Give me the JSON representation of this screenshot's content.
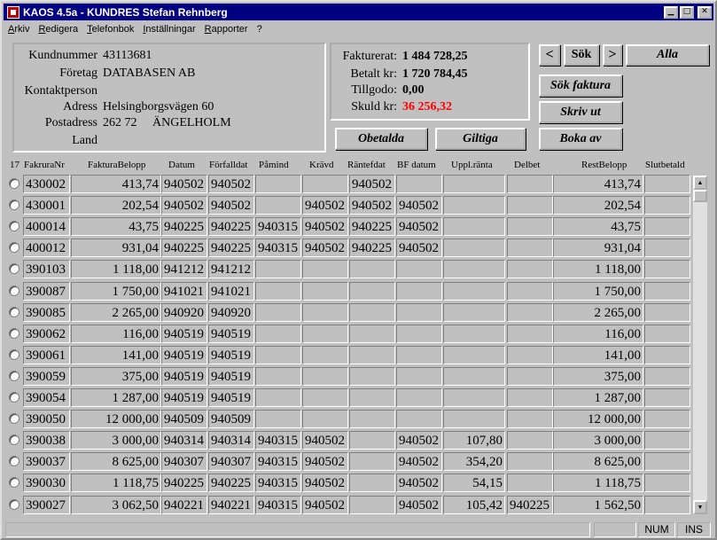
{
  "window": {
    "title": "KAOS 4.5a - KUNDRES  Stefan Rehnberg"
  },
  "menu": [
    "Arkiv",
    "Redigera",
    "Telefonbok",
    "Inställningar",
    "Rapporter",
    "?"
  ],
  "customer": {
    "kundnummer_label": "Kundnummer",
    "kundnummer": "43113681",
    "foretag_label": "Företag",
    "foretag": "DATABASEN AB",
    "kontaktperson_label": "Kontaktperson",
    "kontaktperson": "",
    "adress_label": "Adress",
    "adress": "Helsingborgsvägen 60",
    "postadress_label": "Postadress",
    "postadress": "262 72     ÄNGELHOLM",
    "land_label": "Land",
    "land": ""
  },
  "finance": {
    "fakturerat_label": "Fakturerat:",
    "fakturerat": "1 484 728,25",
    "betalt_label": "Betalt kr:",
    "betalt": "1 720 784,45",
    "tillgodo_label": "Tillgodo:",
    "tillgodo": "0,00",
    "skuld_label": "Skuld kr:",
    "skuld": "36 256,32"
  },
  "buttons": {
    "prev": "<",
    "sok": "Sök",
    "next": ">",
    "alla": "Alla",
    "sok_faktura": "Sök faktura",
    "skriv_ut": "Skriv ut",
    "boka_av": "Boka av",
    "obetalda": "Obetalda",
    "giltiga": "Giltiga"
  },
  "table": {
    "count": "17",
    "headers": [
      "FakruraNr",
      "FakturaBelopp",
      "Datum",
      "Förfalldat",
      "Påmind",
      "Krävd",
      "Räntefdat",
      "BF datum",
      "Uppl.ränta",
      "Delbet",
      "RestBelopp",
      "Slutbetald"
    ],
    "rows": [
      [
        "430002",
        "413,74",
        "940502",
        "940502",
        "",
        "",
        "940502",
        "",
        "",
        "",
        "413,74",
        ""
      ],
      [
        "430001",
        "202,54",
        "940502",
        "940502",
        "",
        "940502",
        "940502",
        "940502",
        "",
        "",
        "202,54",
        ""
      ],
      [
        "400014",
        "43,75",
        "940225",
        "940225",
        "940315",
        "940502",
        "940225",
        "940502",
        "",
        "",
        "43,75",
        ""
      ],
      [
        "400012",
        "931,04",
        "940225",
        "940225",
        "940315",
        "940502",
        "940225",
        "940502",
        "",
        "",
        "931,04",
        ""
      ],
      [
        "390103",
        "1 118,00",
        "941212",
        "941212",
        "",
        "",
        "",
        "",
        "",
        "",
        "1 118,00",
        ""
      ],
      [
        "390087",
        "1 750,00",
        "941021",
        "941021",
        "",
        "",
        "",
        "",
        "",
        "",
        "1 750,00",
        ""
      ],
      [
        "390085",
        "2 265,00",
        "940920",
        "940920",
        "",
        "",
        "",
        "",
        "",
        "",
        "2 265,00",
        ""
      ],
      [
        "390062",
        "116,00",
        "940519",
        "940519",
        "",
        "",
        "",
        "",
        "",
        "",
        "116,00",
        ""
      ],
      [
        "390061",
        "141,00",
        "940519",
        "940519",
        "",
        "",
        "",
        "",
        "",
        "",
        "141,00",
        ""
      ],
      [
        "390059",
        "375,00",
        "940519",
        "940519",
        "",
        "",
        "",
        "",
        "",
        "",
        "375,00",
        ""
      ],
      [
        "390054",
        "1 287,00",
        "940519",
        "940519",
        "",
        "",
        "",
        "",
        "",
        "",
        "1 287,00",
        ""
      ],
      [
        "390050",
        "12 000,00",
        "940509",
        "940509",
        "",
        "",
        "",
        "",
        "",
        "",
        "12 000,00",
        ""
      ],
      [
        "390038",
        "3 000,00",
        "940314",
        "940314",
        "940315",
        "940502",
        "",
        "940502",
        "107,80",
        "",
        "3 000,00",
        ""
      ],
      [
        "390037",
        "8 625,00",
        "940307",
        "940307",
        "940315",
        "940502",
        "",
        "940502",
        "354,20",
        "",
        "8 625,00",
        ""
      ],
      [
        "390030",
        "1 118,75",
        "940225",
        "940225",
        "940315",
        "940502",
        "",
        "940502",
        "54,15",
        "",
        "1 118,75",
        ""
      ],
      [
        "390027",
        "3 062,50",
        "940221",
        "940221",
        "940315",
        "940502",
        "",
        "940502",
        "105,42",
        "940225",
        "1 562,50",
        ""
      ]
    ]
  },
  "statusbar": {
    "num": "NUM",
    "ins": "INS"
  },
  "colors": {
    "titlebar": "#000080",
    "debt": "#ff0000",
    "face": "#c0c0c0"
  }
}
